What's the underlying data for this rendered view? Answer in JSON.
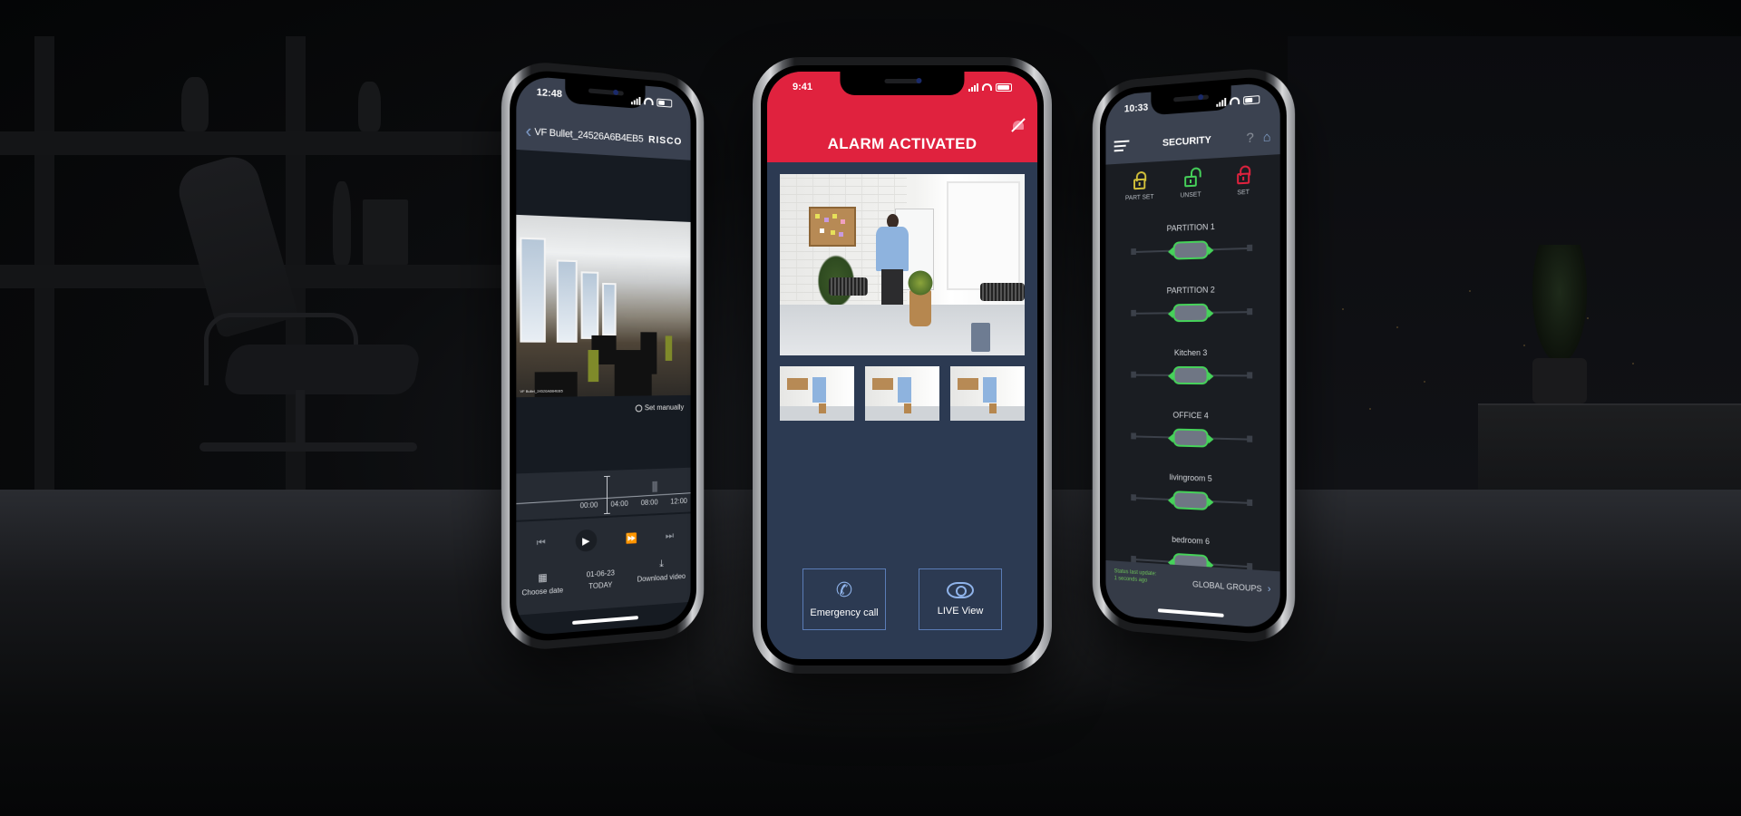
{
  "scene": {
    "description": "Three smartphones showing the RISCO security app on a dark office background"
  },
  "video_phone": {
    "status_bar": {
      "time": "12:48"
    },
    "header": {
      "back_icon": "chevron-left-icon",
      "title": "VF Bullet_24526A6B4EB5",
      "logo": "RISCO"
    },
    "video": {
      "camera_label": "VF Bullet_24526A6B4EB5",
      "alt": "Live office camera frame"
    },
    "set_manually": {
      "icon": "clock-icon",
      "label": "Set manually"
    },
    "timeline": {
      "ticks": [
        "00:00",
        "04:00",
        "08:00",
        "12:00"
      ]
    },
    "playback": {
      "skip_back_icon": "skip-back-icon",
      "play_icon": "play-icon",
      "fast_forward_icon": "fast-forward-icon",
      "skip_forward_icon": "skip-forward-icon"
    },
    "actions": [
      {
        "icon": "calendar-icon",
        "label": "Choose date"
      },
      {
        "icon": "",
        "label": "01-06-23",
        "sublabel": "TODAY"
      },
      {
        "icon": "download-icon",
        "label": "Download video"
      }
    ]
  },
  "alarm_phone": {
    "status_bar": {
      "time": "9:41"
    },
    "header": {
      "title": "ALARM ACTIVATED",
      "siren_icon": "siren-off-icon"
    },
    "colors": {
      "alarm_red": "#e0223e",
      "background_navy": "#2c3a52",
      "button_border": "#5a7cb6"
    },
    "snapshots": {
      "main_alt": "Alarm snapshot: person in office",
      "thumbnails": [
        "Snapshot 1",
        "Snapshot 2",
        "Snapshot 3"
      ]
    },
    "buttons": [
      {
        "icon": "phone-icon",
        "label": "Emergency call"
      },
      {
        "icon": "eye-icon",
        "label": "LIVE View"
      }
    ]
  },
  "security_phone": {
    "status_bar": {
      "time": "10:33"
    },
    "header": {
      "menu_icon": "hamburger-menu-icon",
      "title": "SECURITY",
      "help_icon": "question-icon",
      "home_icon": "home-icon"
    },
    "modes": [
      {
        "label": "PART SET",
        "color": "#d4c23a",
        "icon": "lock-partial-icon"
      },
      {
        "label": "UNSET",
        "color": "#46d25a",
        "icon": "lock-open-icon"
      },
      {
        "label": "SET",
        "color": "#e0223e",
        "icon": "lock-closed-icon"
      }
    ],
    "partitions": [
      {
        "name": "PARTITION 1",
        "state": "UNSET"
      },
      {
        "name": "PARTITION 2",
        "state": "UNSET"
      },
      {
        "name": "Kitchen 3",
        "state": "UNSET"
      },
      {
        "name": "OFFICE 4",
        "state": "UNSET"
      },
      {
        "name": "livingroom 5",
        "state": "UNSET"
      },
      {
        "name": "bedroom 6",
        "state": "UNSET"
      }
    ],
    "footer": {
      "status_line1": "Status last update:",
      "status_line2": "1 seconds ago",
      "global_groups": "GLOBAL GROUPS",
      "chevron_icon": "chevron-right-icon"
    }
  }
}
